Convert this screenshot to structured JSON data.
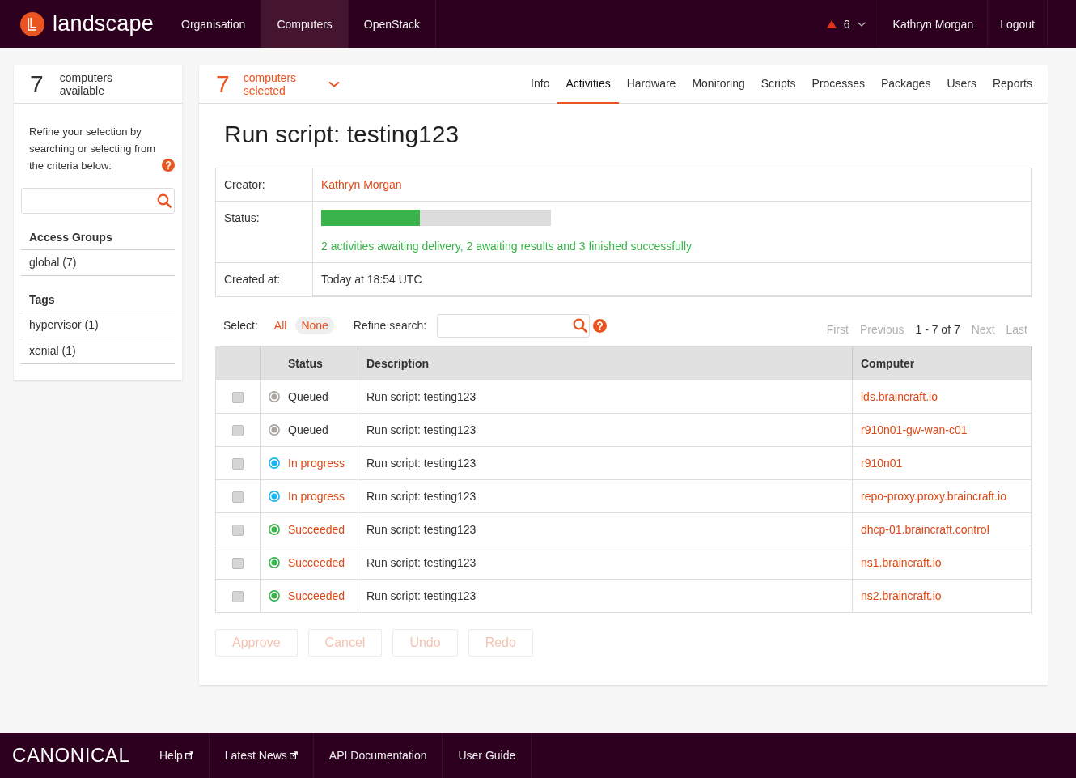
{
  "header": {
    "logo": "landscape",
    "nav": [
      {
        "label": "Organisation",
        "selected": false
      },
      {
        "label": "Computers",
        "selected": true
      },
      {
        "label": "OpenStack",
        "selected": false
      }
    ],
    "alerts": "6",
    "user": "Kathryn Morgan",
    "logout": "Logout"
  },
  "sidebar": {
    "count": "7",
    "count_label": "computers available",
    "hint": "Refine your selection by searching or selecting from the criteria below:",
    "groups": [
      {
        "title": "Access Groups",
        "items": [
          "global (7)"
        ]
      },
      {
        "title": "Tags",
        "items": [
          "hypervisor (1)",
          "xenial (1)"
        ]
      }
    ]
  },
  "main": {
    "selected_count": "7",
    "selected_label": "computers selected",
    "tabs": [
      {
        "label": "Info",
        "selected": false
      },
      {
        "label": "Activities",
        "selected": true
      },
      {
        "label": "Hardware",
        "selected": false
      },
      {
        "label": "Monitoring",
        "selected": false
      },
      {
        "label": "Scripts",
        "selected": false
      },
      {
        "label": "Processes",
        "selected": false
      },
      {
        "label": "Packages",
        "selected": false
      },
      {
        "label": "Users",
        "selected": false
      },
      {
        "label": "Reports",
        "selected": false
      }
    ],
    "title": "Run script: testing123",
    "details": [
      {
        "kind": "link",
        "label": "Creator:",
        "value": "Kathryn Morgan"
      },
      {
        "kind": "progress",
        "label": "Status:",
        "level": 0.43,
        "value": "2 activities awaiting delivery, 2 awaiting results and 3 finished successfully"
      },
      {
        "kind": "text",
        "label": "Created at:",
        "value": "Today at 18:54 UTC"
      }
    ],
    "select": {
      "label": "Select:",
      "options": [
        {
          "label": "All",
          "selected": false
        },
        {
          "label": "None",
          "selected": true
        }
      ]
    },
    "refine": {
      "label": "Refine search:"
    },
    "pagination": [
      {
        "kind": "link",
        "label": "First",
        "disabled": true
      },
      {
        "kind": "link",
        "label": "Previous",
        "disabled": true
      },
      {
        "kind": "range",
        "label": "1 - 7 of 7"
      },
      {
        "kind": "link",
        "label": "Next",
        "disabled": true
      },
      {
        "kind": "link",
        "label": "Last",
        "disabled": true
      }
    ],
    "table": {
      "columns": [
        "Status",
        "Description",
        "Computer"
      ],
      "rows": [
        {
          "checked": false,
          "color": "#aaa59e",
          "status": "Queued",
          "status_link": false,
          "description": "Run script: testing123",
          "computer": "lds.braincraft.io"
        },
        {
          "checked": false,
          "color": "#aaa59e",
          "status": "Queued",
          "status_link": false,
          "description": "Run script: testing123",
          "computer": "r910n01-gw-wan-c01"
        },
        {
          "checked": false,
          "color": "#19b6ee",
          "status": "In progress",
          "status_link": true,
          "description": "Run script: testing123",
          "computer": "r910n01"
        },
        {
          "checked": false,
          "color": "#19b6ee",
          "status": "In progress",
          "status_link": true,
          "description": "Run script: testing123",
          "computer": "repo-proxy.proxy.braincraft.io"
        },
        {
          "checked": false,
          "color": "#38b44a",
          "status": "Succeeded",
          "status_link": true,
          "description": "Run script: testing123",
          "computer": "dhcp-01.braincraft.control"
        },
        {
          "checked": false,
          "color": "#38b44a",
          "status": "Succeeded",
          "status_link": true,
          "description": "Run script: testing123",
          "computer": "ns1.braincraft.io"
        },
        {
          "checked": false,
          "color": "#38b44a",
          "status": "Succeeded",
          "status_link": true,
          "description": "Run script: testing123",
          "computer": "ns2.braincraft.io"
        }
      ]
    },
    "buttons": [
      {
        "label": "Approve",
        "disabled": true
      },
      {
        "label": "Cancel",
        "disabled": true
      },
      {
        "label": "Undo",
        "disabled": true
      },
      {
        "label": "Redo",
        "disabled": true
      }
    ]
  },
  "footer": {
    "brand": "CANONICAL",
    "links": [
      {
        "label": "Help",
        "external": true
      },
      {
        "label": "Latest News",
        "external": true
      },
      {
        "label": "API Documentation",
        "external": false
      },
      {
        "label": "User Guide",
        "external": false
      }
    ]
  }
}
